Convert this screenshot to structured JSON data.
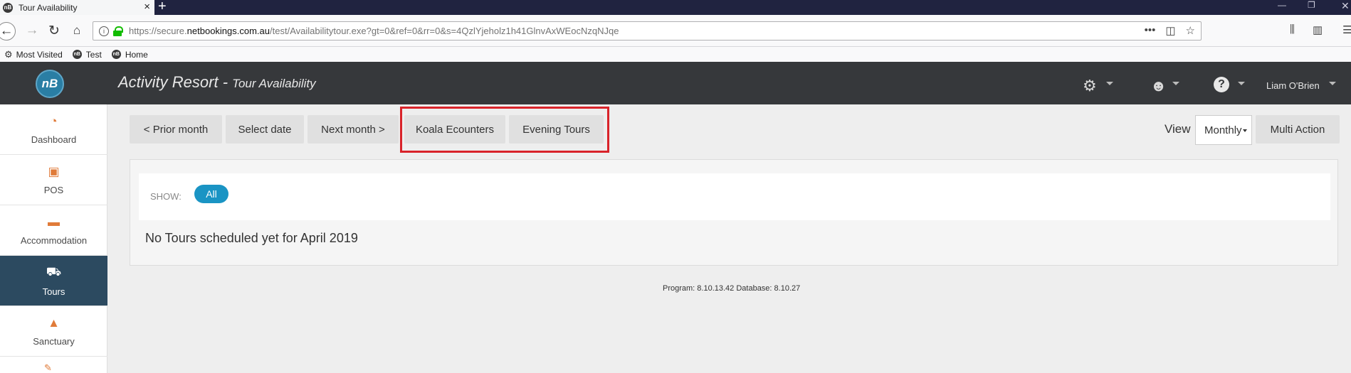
{
  "browser": {
    "tab_title": "Tour Availability",
    "tab_favicon": "nB",
    "url_prefix": "https://secure.",
    "url_host": "netbookings.com.au",
    "url_rest": "/test/Availabilitytour.exe?gt=0&ref=0&rr=0&s=4QzlYjeholz1h41GlnvAxWEocNzqNJqe",
    "bookmarks": [
      {
        "label": "Most Visited",
        "icon": "gear-icon"
      },
      {
        "label": "Test",
        "icon": "nb-favicon"
      },
      {
        "label": "Home",
        "icon": "nb-favicon"
      }
    ]
  },
  "header": {
    "logo_text": "nB",
    "app_name": "Activity Resort",
    "separator": " - ",
    "page_name": "Tour Availability",
    "user_name": "Liam O'Brien"
  },
  "sidebar": {
    "items": [
      {
        "label": "Dashboard",
        "icon": "dashboard-gauge-icon"
      },
      {
        "label": "POS",
        "icon": "pos-icon"
      },
      {
        "label": "Accommodation",
        "icon": "bed-icon"
      },
      {
        "label": "Tours",
        "icon": "tours-icon",
        "active": true
      },
      {
        "label": "Sanctuary",
        "icon": "sanctuary-icon"
      }
    ]
  },
  "toolbar": {
    "prior_month": "< Prior month",
    "select_date": "Select date",
    "next_month": "Next month >",
    "koala": "Koala Ecounters",
    "evening": "Evening Tours",
    "view_label": "View",
    "view_value": "Monthly",
    "multi_action": "Multi Action"
  },
  "panel": {
    "show_label": "SHOW:",
    "filter_all": "All",
    "empty_message": "No Tours scheduled yet for April 2019"
  },
  "footer": {
    "version": "Program: 8.10.13.42 Database: 8.10.27"
  },
  "colors": {
    "header_bg": "#36383b",
    "sidebar_active": "#2c4a60",
    "pill_blue": "#1a94c4",
    "highlight_red": "#d9232a",
    "icon_orange": "#e07b39"
  }
}
